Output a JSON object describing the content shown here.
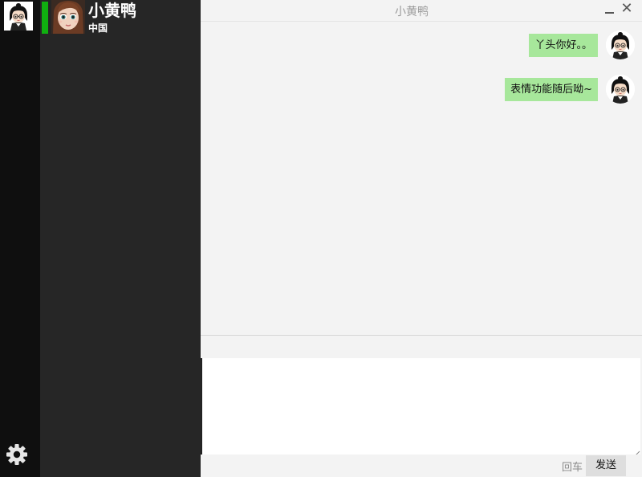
{
  "sidebar": {
    "self_avatar": "avatar-cartoon-girl-glasses",
    "settings_icon": "gear-icon"
  },
  "contacts": [
    {
      "name": "小黄鸭",
      "subtitle": "中国",
      "status_color": "#10b010",
      "avatar": "avatar-doll-girl"
    }
  ],
  "chat": {
    "title": "小黄鸭",
    "minimize_icon": "minimize-icon",
    "close_icon": "close-icon",
    "close_glyph": "✕",
    "messages": [
      {
        "text": "丫头你好。。",
        "from": "self",
        "bubble_color": "#a7e79b"
      },
      {
        "text": "表情功能随后呦~",
        "from": "self",
        "bubble_color": "#a7e79b"
      }
    ],
    "input": {
      "value": "",
      "placeholder": ""
    },
    "enter_hint": "回车",
    "send_label": "发送"
  }
}
